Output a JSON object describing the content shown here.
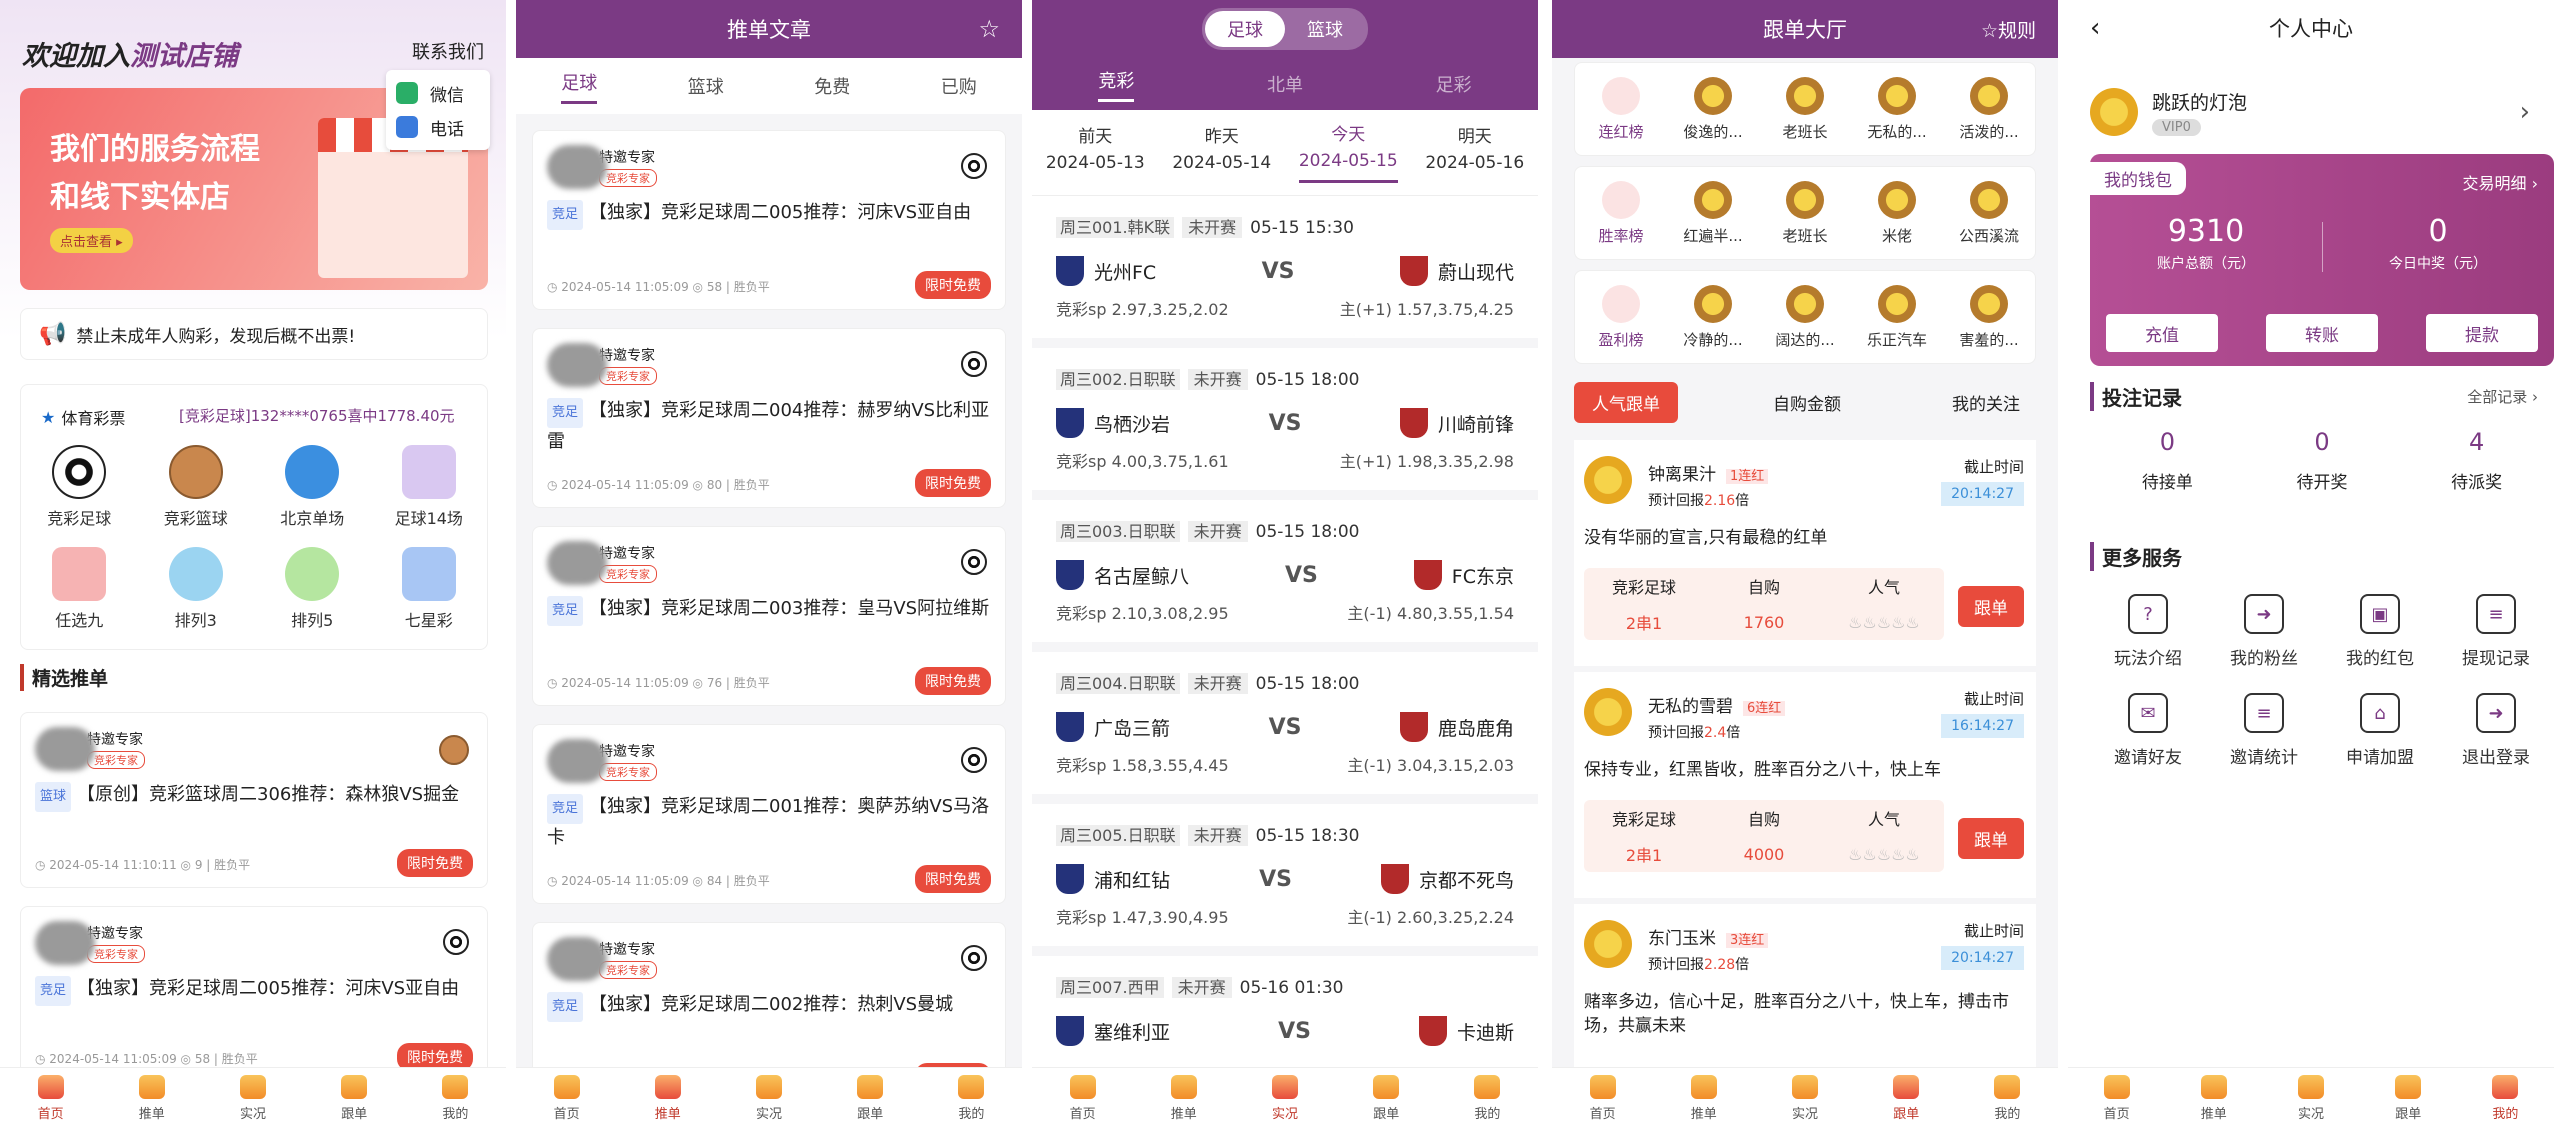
{
  "s1": {
    "title_prefix": "欢迎加入",
    "title_shop": "测试店铺",
    "contact": "联系我们",
    "contact_menu": [
      "微信",
      "电话"
    ],
    "banner_line1": "我们的服务流程",
    "banner_line2": "和线下实体店",
    "banner_btn": "点击查看 ▸",
    "notice": "禁止未成年人购彩，发现后概不出票!",
    "lottery_brand": "体育彩票",
    "win_msg": "[竞彩足球]132****0765喜中1778.40元",
    "games": [
      "竞彩足球",
      "竞彩篮球",
      "北京单场",
      "足球14场",
      "任选九",
      "排列3",
      "排列5",
      "七星彩"
    ],
    "section": "精选推单",
    "posts": [
      {
        "author": "特邀专家",
        "badge": "竞彩专家",
        "type": "篮球",
        "title": "【原创】竞彩篮球周二306推荐：森林狼VS掘金",
        "time": "2024-05-14 11:10:11",
        "views": "9",
        "result": "胜负平",
        "free": "限时免费",
        "sport": "basketball"
      },
      {
        "author": "特邀专家",
        "badge": "竞彩专家",
        "type": "竞足",
        "title": "【独家】竞彩足球周二005推荐：河床VS亚自由",
        "time": "2024-05-14 11:05:09",
        "views": "58",
        "result": "胜负平",
        "free": "限时免费",
        "sport": "football"
      }
    ]
  },
  "s2": {
    "title": "推单文章",
    "tabs": [
      "足球",
      "篮球",
      "免费",
      "已购"
    ],
    "posts": [
      {
        "author": "特邀专家",
        "badge": "竞彩专家",
        "type": "竞足",
        "title": "【独家】竞彩足球周二005推荐：河床VS亚自由",
        "time": "2024-05-14 11:05:09",
        "views": "58",
        "result": "胜负平",
        "free": "限时免费"
      },
      {
        "author": "特邀专家",
        "badge": "竞彩专家",
        "type": "竞足",
        "title": "【独家】竞彩足球周二004推荐：赫罗纳VS比利亚雷",
        "time": "2024-05-14 11:05:09",
        "views": "80",
        "result": "胜负平",
        "free": "限时免费"
      },
      {
        "author": "特邀专家",
        "badge": "竞彩专家",
        "type": "竞足",
        "title": "【独家】竞彩足球周二003推荐：皇马VS阿拉维斯",
        "time": "2024-05-14 11:05:09",
        "views": "76",
        "result": "胜负平",
        "free": "限时免费"
      },
      {
        "author": "特邀专家",
        "badge": "竞彩专家",
        "type": "竞足",
        "title": "【独家】竞彩足球周二001推荐：奥萨苏纳VS马洛卡",
        "time": "2024-05-14 11:05:09",
        "views": "84",
        "result": "胜负平",
        "free": "限时免费"
      },
      {
        "author": "特邀专家",
        "badge": "竞彩专家",
        "type": "竞足",
        "title": "【独家】竞彩足球周二002推荐：热刺VS曼城",
        "time": "2024-05-14 11:05:09",
        "views": "74",
        "result": "胜负平",
        "free": "限时免费"
      }
    ]
  },
  "s3": {
    "seg": [
      "足球",
      "篮球"
    ],
    "tabs": [
      "竞彩",
      "北单",
      "足彩"
    ],
    "dates": [
      {
        "d": "前天",
        "v": "2024-05-13"
      },
      {
        "d": "昨天",
        "v": "2024-05-14"
      },
      {
        "d": "今天",
        "v": "2024-05-15"
      },
      {
        "d": "明天",
        "v": "2024-05-16"
      }
    ],
    "vs": "VS",
    "matches": [
      {
        "code": "周三001.韩K联",
        "status": "未开赛",
        "time": "05-15 15:30",
        "home": "光州FC",
        "away": "蔚山现代",
        "hsp": "竞彩sp 2.97,3.25,2.02",
        "asp": "主(+1) 1.57,3.75,4.25"
      },
      {
        "code": "周三002.日职联",
        "status": "未开赛",
        "time": "05-15 18:00",
        "home": "鸟栖沙岩",
        "away": "川崎前锋",
        "hsp": "竞彩sp 4.00,3.75,1.61",
        "asp": "主(+1) 1.98,3.35,2.98"
      },
      {
        "code": "周三003.日职联",
        "status": "未开赛",
        "time": "05-15 18:00",
        "home": "名古屋鲸八",
        "away": "FC东京",
        "hsp": "竞彩sp 2.10,3.08,2.95",
        "asp": "主(-1) 4.80,3.55,1.54"
      },
      {
        "code": "周三004.日职联",
        "status": "未开赛",
        "time": "05-15 18:00",
        "home": "广岛三箭",
        "away": "鹿岛鹿角",
        "hsp": "竞彩sp 1.58,3.55,4.45",
        "asp": "主(-1) 3.04,3.15,2.03"
      },
      {
        "code": "周三005.日职联",
        "status": "未开赛",
        "time": "05-15 18:30",
        "home": "浦和红钻",
        "away": "京都不死鸟",
        "hsp": "竞彩sp 1.47,3.90,4.95",
        "asp": "主(-1) 2.60,3.25,2.24"
      },
      {
        "code": "周三007.西甲",
        "status": "未开赛",
        "time": "05-16 01:30",
        "home": "塞维利亚",
        "away": "卡迪斯",
        "hsp": "",
        "asp": ""
      }
    ]
  },
  "s4": {
    "title": "跟单大厅",
    "rules": "☆规则",
    "rank_rows": [
      [
        "连红榜",
        "俊逸的...",
        "老班长",
        "无私的...",
        "活泼的..."
      ],
      [
        "胜率榜",
        "红遍半...",
        "老班长",
        "米佬",
        "公西溪流"
      ],
      [
        "盈利榜",
        "冷静的...",
        "阔达的...",
        "乐正汽车",
        "害羞的..."
      ]
    ],
    "filters": [
      "人气跟单",
      "自购金额",
      "我的关注"
    ],
    "orders": [
      {
        "name": "钟离果汁",
        "streak": "1连红",
        "ret": "预计回报",
        "mult": "2.16",
        "unit": "倍",
        "deadline": "截止时间",
        "dtime": "20:14:27",
        "desc": "没有华丽的宣言,只有最稳的红单",
        "h": [
          "竞彩足球",
          "自购",
          "人气"
        ],
        "v": [
          "2串1",
          "1760"
        ],
        "btn": "跟单"
      },
      {
        "name": "无私的雪碧",
        "streak": "6连红",
        "ret": "预计回报",
        "mult": "2.4",
        "unit": "倍",
        "deadline": "截止时间",
        "dtime": "16:14:27",
        "desc": "保持专业，红黑皆收，胜率百分之八十，快上车",
        "h": [
          "竞彩足球",
          "自购",
          "人气"
        ],
        "v": [
          "2串1",
          "4000"
        ],
        "btn": "跟单"
      },
      {
        "name": "东门玉米",
        "streak": "3连红",
        "ret": "预计回报",
        "mult": "2.28",
        "unit": "倍",
        "deadline": "截止时间",
        "dtime": "20:14:27",
        "desc": "赌率多边，信心十足，胜率百分之八十，快上车，搏击市场，共赢未来",
        "h": [],
        "v": [],
        "btn": ""
      }
    ]
  },
  "s5": {
    "title": "个人中心",
    "user": "跳跃的灯泡",
    "vip": "VIP0",
    "wallet": "我的钱包",
    "trade": "交易明细",
    "balance": "9310",
    "balance_label": "账户总额（元）",
    "prize": "0",
    "prize_label": "今日中奖（元）",
    "actions": [
      "充值",
      "转账",
      "提款"
    ],
    "bets_title": "投注记录",
    "all_bets": "全部记录",
    "bets": [
      {
        "n": "0",
        "l": "待接单"
      },
      {
        "n": "0",
        "l": "待开奖"
      },
      {
        "n": "4",
        "l": "待派奖"
      }
    ],
    "more_title": "更多服务",
    "services": [
      "玩法介绍",
      "我的粉丝",
      "我的红包",
      "提现记录",
      "邀请好友",
      "邀请统计",
      "申请加盟",
      "退出登录"
    ]
  },
  "tabbar": [
    "首页",
    "推单",
    "实况",
    "跟单",
    "我的"
  ]
}
